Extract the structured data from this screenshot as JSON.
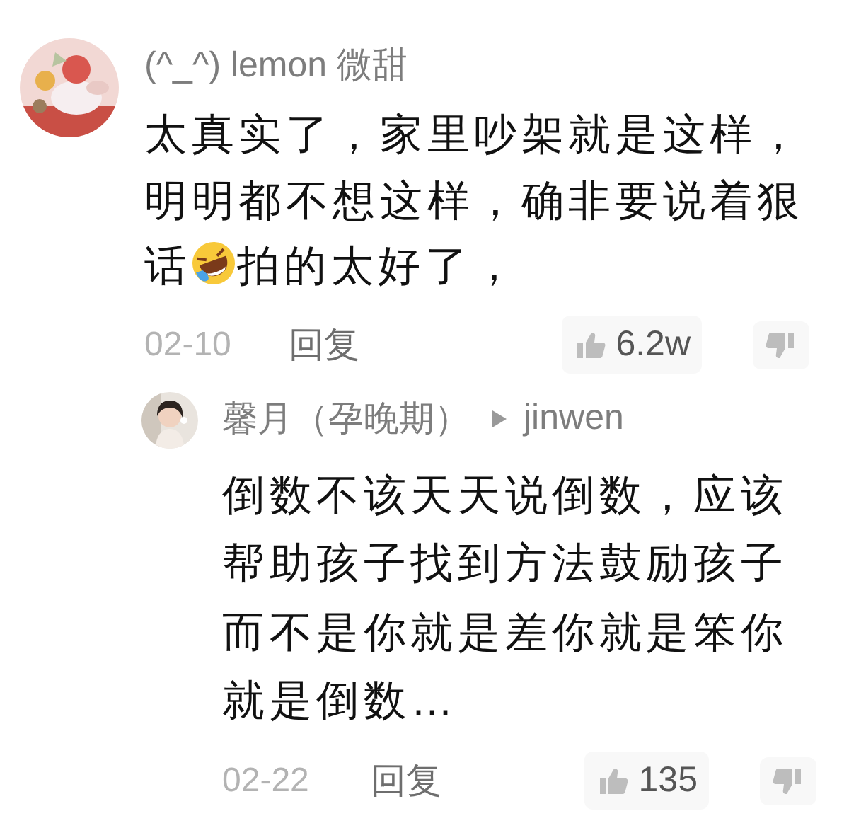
{
  "comments": [
    {
      "avatar": {
        "kind": "picture"
      },
      "name": "(^_^) lemon 微甜",
      "body": [
        {
          "kind": "line",
          "text": "太真实了，家里吵架就是这样，"
        },
        {
          "kind": "line",
          "text": "明明都不想这样，确非要说着狠"
        },
        {
          "kind": "text",
          "text": "话"
        },
        {
          "kind": "emoji"
        },
        {
          "kind": "text",
          "text": "拍的太好了，"
        }
      ],
      "date": "02-10",
      "reply": "回复",
      "likes": "6.2w"
    },
    {
      "avatar": {
        "kind": "picture"
      },
      "name": "馨月（孕晚期）",
      "reply_to": "jinwen",
      "body": [
        {
          "kind": "line",
          "text": "倒数不该天天说倒数，应该帮助孩子找到方法鼓励孩子而不是你就是差你就是笨你就是倒数…"
        }
      ],
      "date": "02-22",
      "reply": "回复",
      "likes": "135"
    }
  ]
}
